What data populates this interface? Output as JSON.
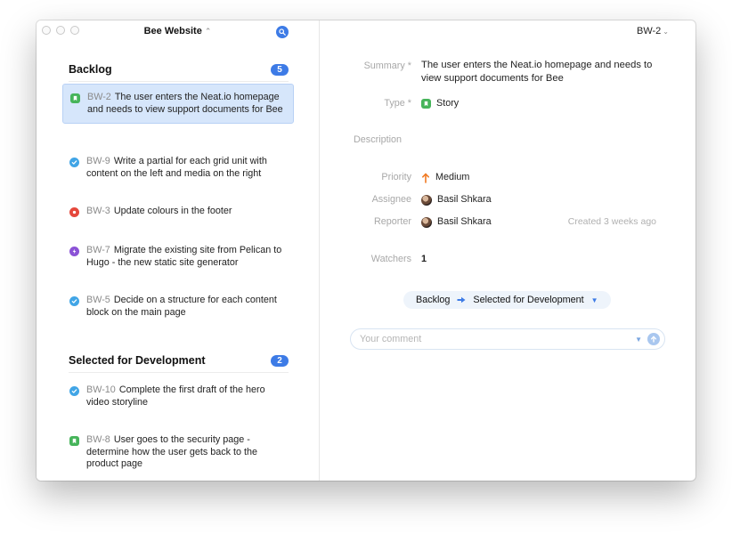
{
  "window": {
    "project_title": "Bee Website",
    "project_chevron": "⌃"
  },
  "sections": [
    {
      "title": "Backlog",
      "count": "5",
      "issues": [
        {
          "key": "BW-2",
          "type": "story",
          "summary": "The user enters the Neat.io homepage and needs to view support documents for Bee",
          "selected": true
        },
        {
          "key": "BW-9",
          "type": "task",
          "summary": "Write a partial for each grid unit with content on the left and media on the right"
        },
        {
          "key": "BW-3",
          "type": "bug",
          "summary": "Update colours in the footer"
        },
        {
          "key": "BW-7",
          "type": "epic",
          "summary": "Migrate the existing site from Pelican to Hugo - the new static site generator"
        },
        {
          "key": "BW-5",
          "type": "task",
          "summary": "Decide on a structure for each content block on the main page"
        }
      ]
    },
    {
      "title": "Selected for Development",
      "count": "2",
      "issues": [
        {
          "key": "BW-10",
          "type": "task",
          "summary": "Complete the first draft of the hero video storyline"
        },
        {
          "key": "BW-8",
          "type": "story",
          "summary": "User goes to the security page - determine how the user gets back to the product page"
        }
      ]
    }
  ],
  "detail": {
    "issue_key": "BW-2",
    "labels": {
      "summary": "Summary *",
      "type": "Type *",
      "description": "Description",
      "priority": "Priority",
      "assignee": "Assignee",
      "reporter": "Reporter",
      "watchers": "Watchers"
    },
    "summary": "The user enters the Neat.io homepage and needs to view support documents for Bee",
    "type": "Story",
    "priority": "Medium",
    "assignee": "Basil Shkara",
    "reporter": "Basil Shkara",
    "created": "Created 3 weeks ago",
    "watchers": "1",
    "status_from": "Backlog",
    "status_to": "Selected for Development",
    "comment_placeholder": "Your comment"
  },
  "colors": {
    "accent": "#3d7be6",
    "selected_bg": "#d6e6fb",
    "story": "#46b45a",
    "task": "#41a5e6",
    "bug": "#e5483c",
    "epic": "#8b52d6",
    "priority_medium": "#f07a22"
  },
  "icons": {
    "story": "bookmark-icon",
    "task": "check-icon",
    "bug": "bug-dot-icon",
    "epic": "lightning-icon",
    "search": "search-icon",
    "send": "send-arrow-icon"
  }
}
